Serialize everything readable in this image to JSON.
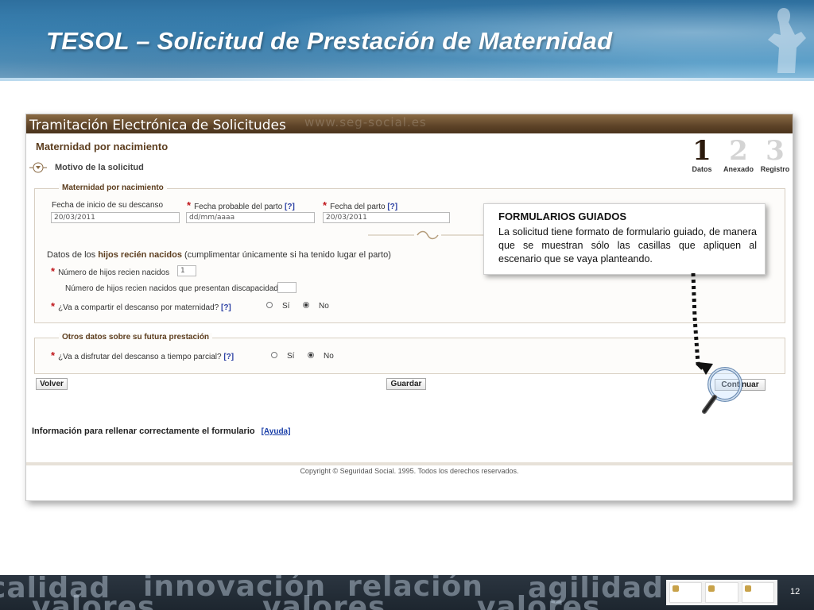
{
  "slide": {
    "title": "TESOL – Solicitud de Prestación de Maternidad",
    "page_number": "12"
  },
  "app": {
    "header_label": "Tramitación Electrónica de Solicitudes",
    "header_ghost": "www.seg-social.es",
    "page_heading": "Maternidad por nacimiento",
    "step_label": "Motivo de la solicitud",
    "steps": [
      {
        "number": "1",
        "caption": "Datos",
        "active": true
      },
      {
        "number": "2",
        "caption": "Anexado",
        "active": false
      },
      {
        "number": "3",
        "caption": "Registro",
        "active": false
      }
    ]
  },
  "section1": {
    "legend": "Maternidad por nacimiento",
    "field_start_label": "Fecha de inicio de su descanso",
    "field_start_value": "20/03/2011",
    "field_probable_label": "Fecha probable del parto",
    "field_probable_value": "dd/mm/aaaa",
    "field_birth_label": "Fecha del parto",
    "field_birth_value": "20/03/2011",
    "help": "[?]",
    "children_intro_prefix": "Datos de los ",
    "children_intro_bold": "hijos recién nacidos",
    "children_intro_suffix": " (cumplimentar únicamente si ha tenido lugar el parto)",
    "children_count_label": "Número de hijos recien nacidos",
    "children_count_value": "1",
    "children_disabled_label": "Número de hijos recien nacidos que presentan discapacidad",
    "children_disabled_value": "",
    "share_question": "¿Va a compartir el descanso por maternidad?",
    "yes": "Sí",
    "no": "No"
  },
  "section2": {
    "legend": "Otros datos sobre su futura prestación",
    "parttime_question": "¿Va a disfrutar del descanso a tiempo parcial?",
    "yes": "Sí",
    "no": "No"
  },
  "buttons": {
    "back": "Volver",
    "save": "Guardar",
    "continue": "Continuar"
  },
  "info": {
    "text": "Información para rellenar correctamente el formulario",
    "link": "[Ayuda]",
    "copyright": "Copyright © Seguridad Social. 1995. Todos los derechos reservados."
  },
  "callout": {
    "title": "FORMULARIOS GUIADOS",
    "body": "La solicitud tiene formato de formulario guiado, de manera que se muestran sólo las casillas que apliquen al escenario que se vaya planteando."
  },
  "bottom_words": [
    "calidad",
    "innovación",
    "relación",
    "agilidad",
    "valores",
    "valores",
    "valores"
  ],
  "colors": {
    "banner": "#3d86b6",
    "brown_header": "#5e4428",
    "required_star": "#c0171b",
    "help_link": "#2b3fa3"
  }
}
